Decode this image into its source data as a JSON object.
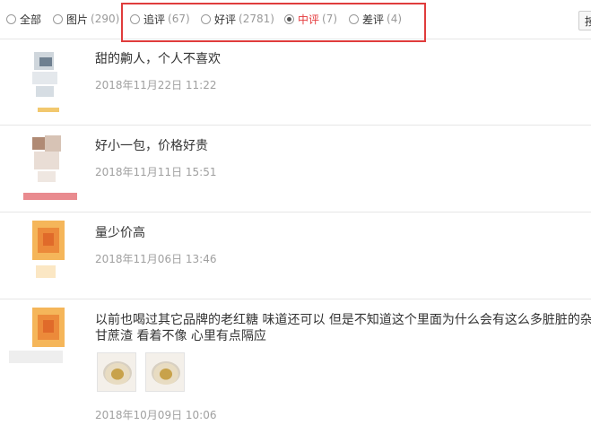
{
  "filters": [
    {
      "label": "全部",
      "count": "",
      "checked": false
    },
    {
      "label": "图片",
      "count": "(290)",
      "checked": false
    },
    {
      "label": "追评",
      "count": "(67)",
      "checked": false
    },
    {
      "label": "好评",
      "count": "(2781)",
      "checked": false
    },
    {
      "label": "中评",
      "count": "(7)",
      "checked": true
    },
    {
      "label": "差评",
      "count": "(4)",
      "checked": false
    }
  ],
  "reviews": [
    {
      "text": "甜的齁人，个人不喜欢",
      "date": "2018年11月22日 11:22"
    },
    {
      "text": "好小一包，价格好贵",
      "date": "2018年11月11日 15:51"
    },
    {
      "text": "量少价高",
      "date": "2018年11月06日 13:46"
    },
    {
      "text": "以前也喝过其它品牌的老红糖 味道还可以 但是不知道这个里面为什么会有这么多脏脏的杂甘蔗渣 看着不像 心里有点隔应",
      "date": "2018年10月09日 10:06"
    }
  ],
  "colors": {
    "accent": "#e4393c",
    "highlight": "#e03c3c",
    "muted": "#999999"
  }
}
